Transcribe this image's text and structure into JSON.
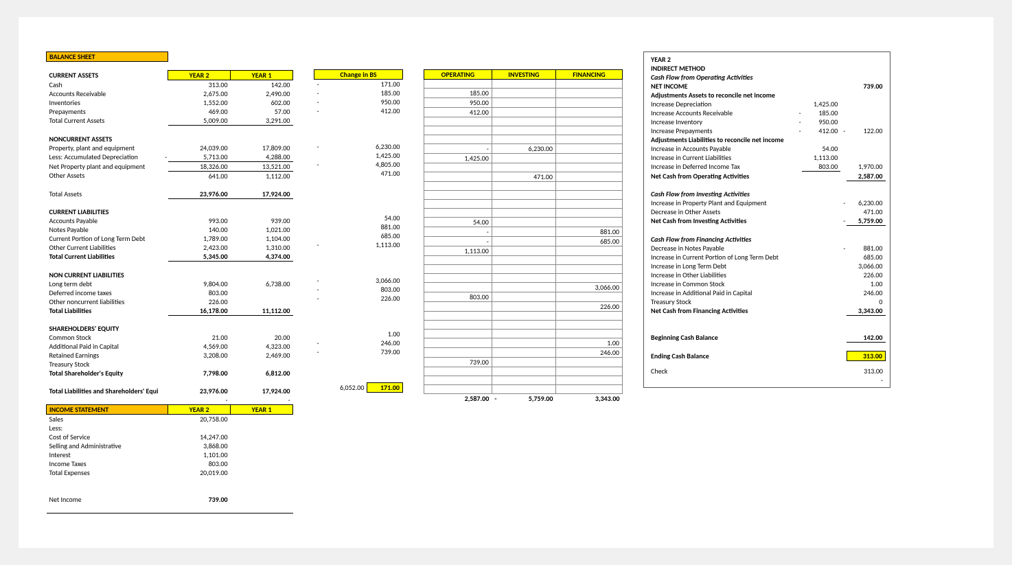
{
  "balanceSheet": {
    "title": "BALANCE SHEET",
    "yearHdr2": "YEAR 2",
    "yearHdr1": "YEAR 1",
    "sections": {
      "currentAssets": {
        "title": "CURRENT ASSETS",
        "rows": [
          {
            "label": "Cash",
            "y2": "313.00",
            "y1": "142.00"
          },
          {
            "label": "Accounts Receivable",
            "y2": "2,675.00",
            "y1": "2,490.00"
          },
          {
            "label": "Inventories",
            "y2": "1,552.00",
            "y1": "602.00"
          },
          {
            "label": "Prepayments",
            "y2": "469.00",
            "y1": "57.00"
          }
        ],
        "total": {
          "label": "Total Current Assets",
          "y2": "5,009.00",
          "y1": "3,291.00"
        }
      },
      "noncurrentAssets": {
        "title": "NONCURRENT ASSETS",
        "rows": [
          {
            "label": "Property, plant and equipment",
            "y2": "24,039.00",
            "y1": "17,809.00"
          },
          {
            "label": "Less: Accumulated Depreciation",
            "y2": "5,713.00",
            "y1": "4,288.00",
            "neg": true,
            "underline": true
          },
          {
            "label": "Net Property plant and equipment",
            "y2": "18,326.00",
            "y1": "13,521.00",
            "underline": true
          },
          {
            "label": "Other Assets",
            "y2": "641.00",
            "y1": "1,112.00"
          }
        ],
        "total": {
          "label": "Total Assets",
          "y2": "23,976.00",
          "y1": "17,924.00"
        }
      },
      "currentLiabilities": {
        "title": "CURRENT LIABILITIES",
        "rows": [
          {
            "label": "Accounts Payable",
            "y2": "993.00",
            "y1": "939.00"
          },
          {
            "label": "Notes Payable",
            "y2": "140.00",
            "y1": "1,021.00"
          },
          {
            "label": "Current Portion of Long Term Debt",
            "y2": "1,789.00",
            "y1": "1,104.00"
          },
          {
            "label": "Other Current Liabilities",
            "y2": "2,423.00",
            "y1": "1,310.00"
          }
        ],
        "total": {
          "label": "Total Current Liabilities",
          "y2": "5,345.00",
          "y1": "4,374.00"
        }
      },
      "nonCurrentLiabilities": {
        "title": "NON CURRENT LIABILITIES",
        "rows": [
          {
            "label": "Long term debt",
            "y2": "9,804.00",
            "y1": "6,738.00"
          },
          {
            "label": "Deferred income taxes",
            "y2": "803.00",
            "y1": ""
          },
          {
            "label": "Other noncurrent liabilities",
            "y2": "226.00",
            "y1": ""
          }
        ],
        "total": {
          "label": "Total Liabilities",
          "y2": "16,178.00",
          "y1": "11,112.00"
        }
      },
      "equity": {
        "title": "SHAREHOLDERS' EQUITY",
        "rows": [
          {
            "label": "Common Stock",
            "y2": "21.00",
            "y1": "20.00"
          },
          {
            "label": "Additional Paid in Capital",
            "y2": "4,569.00",
            "y1": "4,323.00"
          },
          {
            "label": "Retained Earnings",
            "y2": "3,208.00",
            "y1": "2,469.00"
          },
          {
            "label": "Treasury Stock",
            "y2": "",
            "y1": ""
          }
        ],
        "total": {
          "label": "Total Shareholder's Equity",
          "y2": "7,798.00",
          "y1": "6,812.00"
        }
      },
      "grandTotal": {
        "label": "Total Liabilities and Shareholders' Equi",
        "y2": "23,976.00",
        "y1": "17,924.00"
      }
    }
  },
  "incomeStatement": {
    "title": "INCOME STATEMENT",
    "yearHdr2": "YEAR 2",
    "yearHdr1": "YEAR 1",
    "rows": [
      {
        "label": "Sales",
        "y2": "20,758.00"
      },
      {
        "label": "Less:",
        "y2": ""
      },
      {
        "label": "Cost of Service",
        "y2": "14,247.00"
      },
      {
        "label": "Selling and Administrative",
        "y2": "3,868.00"
      },
      {
        "label": "Interest",
        "y2": "1,101.00"
      },
      {
        "label": "Income Taxes",
        "y2": "803.00"
      },
      {
        "label": "Total Expenses",
        "y2": "20,019.00"
      }
    ],
    "net": {
      "label": "Net Income",
      "y2": "739.00"
    }
  },
  "changeInBS": {
    "title": "Change in BS",
    "rows": [
      {
        "val": "171.00",
        "neg": true
      },
      {
        "val": "185.00",
        "neg": true
      },
      {
        "val": "950.00",
        "neg": true
      },
      {
        "val": "412.00",
        "neg": true
      },
      {
        "val": ""
      },
      {
        "val": ""
      },
      {
        "val": ""
      },
      {
        "val": "6,230.00",
        "neg": true
      },
      {
        "val": "1,425.00"
      },
      {
        "val": "4,805.00",
        "neg": true
      },
      {
        "val": "471.00"
      },
      {
        "val": ""
      },
      {
        "val": ""
      },
      {
        "val": ""
      },
      {
        "val": ""
      },
      {
        "val": "54.00"
      },
      {
        "val": "881.00"
      },
      {
        "val": "685.00"
      },
      {
        "val": "1,113.00",
        "neg": true
      },
      {
        "val": ""
      },
      {
        "val": ""
      },
      {
        "val": ""
      },
      {
        "val": "3,066.00",
        "neg": true
      },
      {
        "val": "803.00",
        "neg": true
      },
      {
        "val": "226.00",
        "neg": true
      },
      {
        "val": ""
      },
      {
        "val": ""
      },
      {
        "val": ""
      },
      {
        "val": "1.00"
      },
      {
        "val": "246.00",
        "neg": true
      },
      {
        "val": "739.00",
        "neg": true
      },
      {
        "val": ""
      },
      {
        "val": ""
      },
      {
        "val": ""
      }
    ],
    "footerLeft": "6,052.00",
    "footerRight": "171.00"
  },
  "activityGrid": {
    "headers": [
      "OPERATING",
      "INVESTING",
      "FINANCING"
    ],
    "rows": [
      [
        "",
        "",
        ""
      ],
      [
        "185.00",
        "",
        ""
      ],
      [
        "950.00",
        "",
        ""
      ],
      [
        "412.00",
        "",
        ""
      ],
      [
        "",
        "",
        ""
      ],
      [
        "",
        "",
        ""
      ],
      [
        "",
        "",
        ""
      ],
      [
        "-",
        "6,230.00",
        ""
      ],
      [
        "1,425.00",
        "",
        ""
      ],
      [
        "",
        "",
        ""
      ],
      [
        "",
        "471.00",
        ""
      ],
      [
        "",
        "",
        ""
      ],
      [
        "",
        "",
        ""
      ],
      [
        "",
        "",
        ""
      ],
      [
        "",
        "",
        ""
      ],
      [
        "54.00",
        "",
        ""
      ],
      [
        "-",
        "",
        "881.00"
      ],
      [
        "-",
        "",
        "685.00"
      ],
      [
        "1,113.00",
        "",
        ""
      ],
      [
        "",
        "",
        ""
      ],
      [
        "",
        "",
        ""
      ],
      [
        "",
        "",
        ""
      ],
      [
        "",
        "",
        "3,066.00"
      ],
      [
        "803.00",
        "",
        ""
      ],
      [
        "",
        "",
        "226.00"
      ],
      [
        "",
        "",
        ""
      ],
      [
        "",
        "",
        ""
      ],
      [
        "",
        "",
        ""
      ],
      [
        "",
        "",
        "1.00"
      ],
      [
        "",
        "",
        "246.00"
      ],
      [
        "739.00",
        "",
        ""
      ],
      [
        "",
        "",
        ""
      ],
      [
        "",
        "",
        ""
      ],
      [
        "",
        "",
        ""
      ]
    ],
    "footer": [
      "2,587.00",
      "5,759.00",
      "3,343.00"
    ],
    "footerNeg": [
      false,
      true,
      false
    ]
  },
  "indirect": {
    "yearTitle": "YEAR 2",
    "method": "INDIRECT METHOD",
    "sections": [
      {
        "title": "Cash Flow from Operating Activities",
        "italic": true,
        "rows": [
          {
            "label": "NET INCOME",
            "v2": "739.00",
            "bold": true
          },
          {
            "label": "Adjustments Assets to reconcile net income",
            "bold": true
          },
          {
            "label": "Increase Depreciation",
            "v1": "1,425.00"
          },
          {
            "label": "Increase Accounts Receivable",
            "neg1": true,
            "v1": "185.00"
          },
          {
            "label": "Increase Inventory",
            "neg1": true,
            "v1": "950.00"
          },
          {
            "label": "Increase Prepayments",
            "neg1": true,
            "v1": "412.00",
            "neg2": true,
            "v2": "122.00"
          },
          {
            "label": "Adjustments Liabilities to reconcile net income",
            "bold": true
          },
          {
            "label": "Increase in Accounts Payable",
            "v1": "54.00"
          },
          {
            "label": "Increase in Current Liabilities",
            "v1": "1,113.00"
          },
          {
            "label": "Increase in Deferred Income Tax",
            "v1": "803.00",
            "v2": "1,970.00",
            "uline1": true
          },
          {
            "label": "Net Cash from Operating Activities",
            "bold": true,
            "v2": "2,587.00",
            "uline2": true
          }
        ]
      },
      {
        "title": "Cash Flow from Investing Activities",
        "italic": true,
        "rows": [
          {
            "label": "Increase in Property Plant and Equipment",
            "neg2": true,
            "v2": "6,230.00"
          },
          {
            "label": "Decrease in Other Assets",
            "v2": "471.00"
          },
          {
            "label": "Net Cash from Investing Activities",
            "bold": true,
            "neg2": true,
            "v2": "5,759.00",
            "uline2": true
          }
        ]
      },
      {
        "title": "Cash Flow from Financing Activities",
        "italic": true,
        "rows": [
          {
            "label": "Decrease in Notes Payable",
            "neg2": true,
            "v2": "881.00"
          },
          {
            "label": "Increase in Current Portion of Long Term Debt",
            "v2": "685.00"
          },
          {
            "label": "Increase in Long Term Debt",
            "v2": "3,066.00"
          },
          {
            "label": "Increase in Other Liabilities",
            "v2": "226.00"
          },
          {
            "label": "Increase in Common Stock",
            "v2": "1.00"
          },
          {
            "label": "Increase in Additional Paid in Capital",
            "v2": "246.00"
          },
          {
            "label": "Treasury Stock",
            "v2": "0"
          },
          {
            "label": "Net Cash from Financing Activities",
            "bold": true,
            "v2": "3,343.00",
            "uline2": true
          }
        ]
      }
    ],
    "begin": {
      "label": "Beginning Cash Balance",
      "v2": "142.00"
    },
    "end": {
      "label": "Ending Cash Balance",
      "v2": "313.00"
    },
    "check": {
      "label": "Check",
      "v2": "313.00",
      "dash": "-"
    }
  }
}
